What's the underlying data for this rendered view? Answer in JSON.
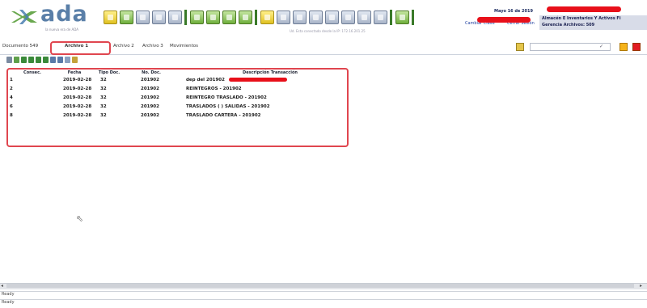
{
  "header": {
    "logo_text": "ada",
    "logo_sub": "la nueva era de ADA",
    "connected_msg": "Ud. Esta conectado desde la IP: 172.16.201.25",
    "date_text": "Mayo 16 de 2019",
    "change_password_label": "Cambiar Clave",
    "close_session_label": "Cerrar Sesión",
    "user_line1": "Almacén E Inventarios Y Activos Fi",
    "user_line2": "Gerencia Archivos: 509"
  },
  "tabs": [
    {
      "label": "Documento 549"
    },
    {
      "label": "Archivo 1"
    },
    {
      "label": "Archivo 2"
    },
    {
      "label": "Archivo 3"
    },
    {
      "label": "Movimientos"
    }
  ],
  "search": {
    "placeholder": ""
  },
  "grid": {
    "columns": [
      "Consec.",
      "Fecha",
      "Tipo Doc.",
      "No. Doc.",
      "Descripción Transacción"
    ],
    "rows": [
      {
        "consec": "1",
        "fecha": "2019-02-28",
        "tipo": "32",
        "nodoc": "201902",
        "desc": "dep del 201902"
      },
      {
        "consec": "2",
        "fecha": "2019-02-28",
        "tipo": "32",
        "nodoc": "201902",
        "desc": "REINTEGROS - 201902"
      },
      {
        "consec": "4",
        "fecha": "2019-02-28",
        "tipo": "32",
        "nodoc": "201902",
        "desc": "REINTEGRO TRASLADO - 201902"
      },
      {
        "consec": "6",
        "fecha": "2019-02-28",
        "tipo": "32",
        "nodoc": "201902",
        "desc": "TRASLADOS ( ) SALIDAS - 201902"
      },
      {
        "consec": "8",
        "fecha": "2019-02-28",
        "tipo": "32",
        "nodoc": "201902",
        "desc": "TRASLADO CARTERA - 201902"
      }
    ]
  },
  "status": {
    "line1": "Ready",
    "line2": "Ready"
  },
  "colors": {
    "accent": "#e0464f",
    "brand": "#5a7fa8",
    "redaction": "#e8101a"
  }
}
